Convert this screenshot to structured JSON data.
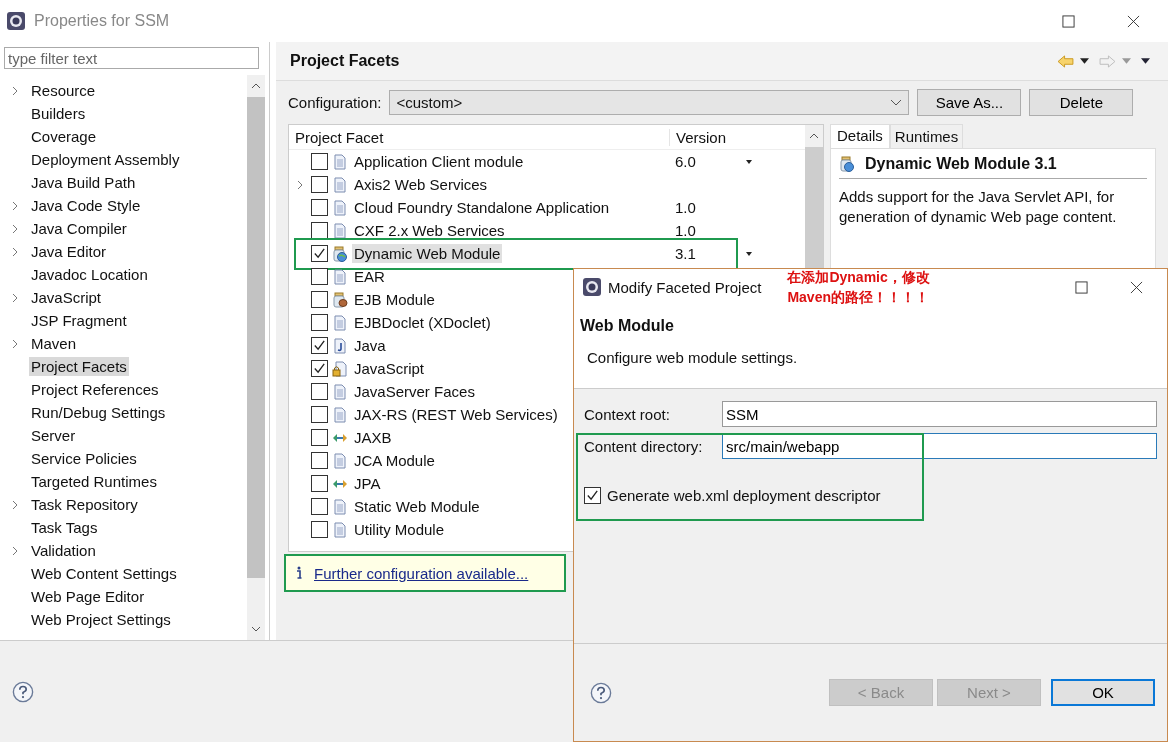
{
  "window": {
    "title": "Properties for SSM"
  },
  "filter": {
    "placeholder": "type filter text"
  },
  "sidebar": {
    "items": [
      {
        "label": "Resource",
        "expandable": true,
        "selected": false
      },
      {
        "label": "Builders",
        "expandable": false,
        "selected": false
      },
      {
        "label": "Coverage",
        "expandable": false,
        "selected": false
      },
      {
        "label": "Deployment Assembly",
        "expandable": false,
        "selected": false
      },
      {
        "label": "Java Build Path",
        "expandable": false,
        "selected": false
      },
      {
        "label": "Java Code Style",
        "expandable": true,
        "selected": false
      },
      {
        "label": "Java Compiler",
        "expandable": true,
        "selected": false
      },
      {
        "label": "Java Editor",
        "expandable": true,
        "selected": false
      },
      {
        "label": "Javadoc Location",
        "expandable": false,
        "selected": false
      },
      {
        "label": "JavaScript",
        "expandable": true,
        "selected": false
      },
      {
        "label": "JSP Fragment",
        "expandable": false,
        "selected": false
      },
      {
        "label": "Maven",
        "expandable": true,
        "selected": false
      },
      {
        "label": "Project Facets",
        "expandable": false,
        "selected": true
      },
      {
        "label": "Project References",
        "expandable": false,
        "selected": false
      },
      {
        "label": "Run/Debug Settings",
        "expandable": false,
        "selected": false
      },
      {
        "label": "Server",
        "expandable": false,
        "selected": false
      },
      {
        "label": "Service Policies",
        "expandable": false,
        "selected": false
      },
      {
        "label": "Targeted Runtimes",
        "expandable": false,
        "selected": false
      },
      {
        "label": "Task Repository",
        "expandable": true,
        "selected": false
      },
      {
        "label": "Task Tags",
        "expandable": false,
        "selected": false
      },
      {
        "label": "Validation",
        "expandable": true,
        "selected": false
      },
      {
        "label": "Web Content Settings",
        "expandable": false,
        "selected": false
      },
      {
        "label": "Web Page Editor",
        "expandable": false,
        "selected": false
      },
      {
        "label": "Web Project Settings",
        "expandable": false,
        "selected": false
      }
    ]
  },
  "page": {
    "title": "Project Facets",
    "configuration_label": "Configuration:",
    "configuration_value": "<custom>",
    "buttons": [
      "Save As...",
      "Delete"
    ]
  },
  "facets": {
    "columns": [
      "Project Facet",
      "Version"
    ],
    "rows": [
      {
        "name": "Application Client module",
        "kind": "document",
        "version": "6.0",
        "version_menu": true,
        "checked": false,
        "expandable": false,
        "selected": false,
        "highlighted": false
      },
      {
        "name": "Axis2 Web Services",
        "kind": "document",
        "version_menu": false,
        "checked": false,
        "expandable": true,
        "selected": false,
        "highlighted": false
      },
      {
        "name": "Cloud Foundry Standalone Application",
        "kind": "document",
        "version": "1.0",
        "version_menu": false,
        "checked": false,
        "expandable": false,
        "selected": false,
        "highlighted": false
      },
      {
        "name": "CXF 2.x Web Services",
        "kind": "document",
        "version": "1.0",
        "version_menu": false,
        "checked": false,
        "expandable": false,
        "selected": false,
        "highlighted": false
      },
      {
        "name": "Dynamic Web Module",
        "kind": "module",
        "version": "3.1",
        "version_menu": true,
        "checked": true,
        "expandable": false,
        "selected": true,
        "highlighted": true
      },
      {
        "name": "EAR",
        "kind": "document",
        "checked": false,
        "expandable": false,
        "selected": false,
        "highlighted": false
      },
      {
        "name": "EJB Module",
        "kind": "bean",
        "checked": false,
        "expandable": false,
        "selected": false,
        "highlighted": false
      },
      {
        "name": "EJBDoclet (XDoclet)",
        "kind": "document",
        "checked": false,
        "expandable": false,
        "selected": false,
        "highlighted": false
      },
      {
        "name": "Java",
        "kind": "java",
        "checked": true,
        "expandable": false,
        "selected": false,
        "highlighted": false
      },
      {
        "name": "JavaScript",
        "kind": "script",
        "checked": true,
        "expandable": false,
        "selected": false,
        "highlighted": false
      },
      {
        "name": "JavaServer Faces",
        "kind": "document",
        "checked": false,
        "expandable": false,
        "selected": false,
        "highlighted": false
      },
      {
        "name": "JAX-RS (REST Web Services)",
        "kind": "document",
        "checked": false,
        "expandable": false,
        "selected": false,
        "highlighted": false
      },
      {
        "name": "JAXB",
        "kind": "binding",
        "checked": false,
        "expandable": false,
        "selected": false,
        "highlighted": false
      },
      {
        "name": "JCA Module",
        "kind": "document",
        "checked": false,
        "expandable": false,
        "selected": false,
        "highlighted": false
      },
      {
        "name": "JPA",
        "kind": "binding",
        "checked": false,
        "expandable": false,
        "selected": false,
        "highlighted": false
      },
      {
        "name": "Static Web Module",
        "kind": "document",
        "checked": false,
        "expandable": false,
        "selected": false,
        "highlighted": false
      },
      {
        "name": "Utility Module",
        "kind": "document",
        "checked": false,
        "expandable": false,
        "selected": false,
        "highlighted": false
      }
    ]
  },
  "further_config": {
    "text": "Further configuration available...",
    "highlighted": true
  },
  "details": {
    "tabs": [
      {
        "label": "Details",
        "selected": true
      },
      {
        "label": "Runtimes",
        "selected": false
      }
    ],
    "title": "Dynamic Web Module 3.1",
    "description": "Adds support for the Java Servlet API, for generation of dynamic Web page content."
  },
  "dialog": {
    "title": "Modify Faceted Project",
    "annotation": "在添加Dynamic，修改Maven的路径！！！！",
    "heading": "Web Module",
    "description": "Configure web module settings.",
    "fields": [
      {
        "label": "Context root:",
        "value": "SSM",
        "focused": false
      },
      {
        "label": "Content directory:",
        "value": "src/main/webapp",
        "focused": true
      }
    ],
    "checkbox": {
      "label": "Generate web.xml deployment descriptor",
      "checked": true
    },
    "highlighted": true,
    "buttons": [
      {
        "label": "< Back",
        "disabled": true,
        "default": false
      },
      {
        "label": "Next >",
        "disabled": true,
        "default": false
      },
      {
        "label": "OK",
        "disabled": false,
        "default": true
      }
    ]
  }
}
